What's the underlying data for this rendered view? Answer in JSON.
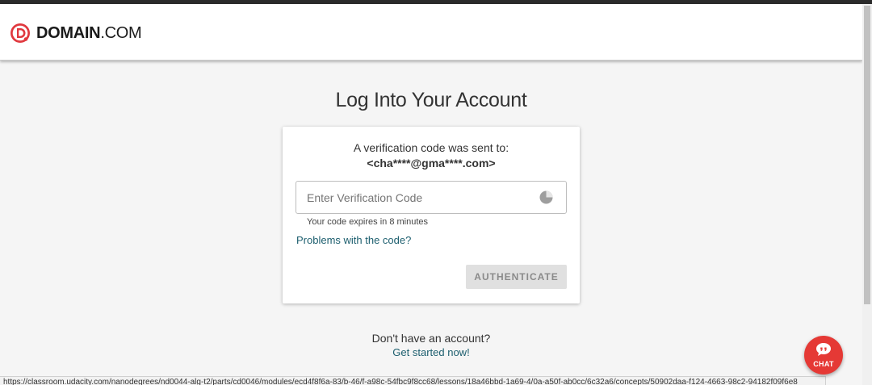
{
  "colors": {
    "brand_red": "#e0383e",
    "link_teal": "#1c5e6e",
    "chat_red": "#e53935",
    "button_disabled_bg": "#e0e0e0",
    "button_disabled_text": "#8a8a8a"
  },
  "header": {
    "logo_icon": "domain-d-logo-icon",
    "logo_bold": "DOMAIN",
    "logo_thin": ".COM"
  },
  "page": {
    "title": "Log Into Your Account"
  },
  "verification": {
    "sent_to_text": "A verification code was sent to:",
    "masked_email": "<cha****@gma****.com>",
    "input_value": "",
    "input_placeholder": "Enter Verification Code",
    "timer_icon": "timer-pie-icon",
    "expires_text": "Your code expires in 8 minutes",
    "problems_link": "Problems with the code?",
    "authenticate_label": "AUTHENTICATE"
  },
  "signup": {
    "prompt": "Don't have an account?",
    "link": "Get started now!"
  },
  "status_bar": {
    "url": "https://classroom.udacity.com/nanodegrees/nd0044-alg-t2/parts/cd0046/modules/ecd4f8f6a-83/b-46/f-a98c-54fbc9f8cc68/lessons/18a46bbd-1a69-4/0a-a50f-ab0cc/6c32a6/concepts/50902daa-f124-4663-98c2-94182f09f6e8"
  },
  "chat": {
    "icon": "chat-bubble-icon",
    "label": "CHAT"
  }
}
